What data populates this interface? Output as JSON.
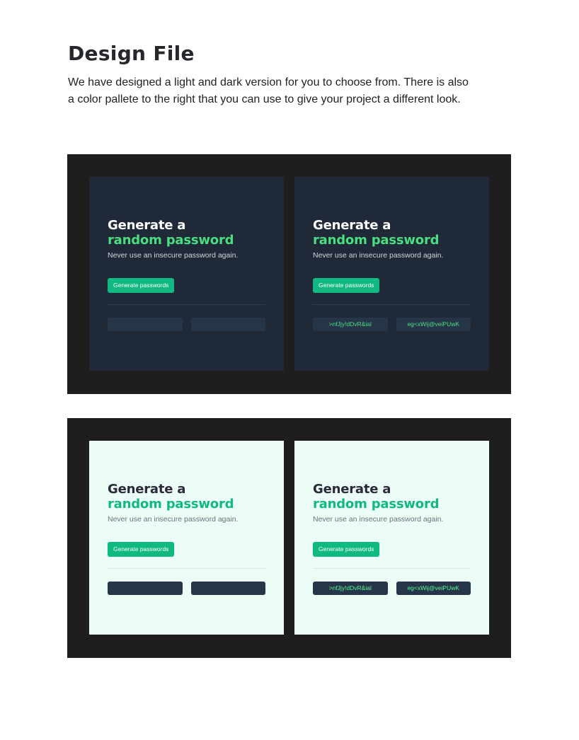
{
  "header": {
    "title": "Design File",
    "intro": "We have designed a light and dark version for you to choose from. There is also a color pallete to the right that you can use to give your project a different look."
  },
  "card": {
    "heading_line1": "Generate a",
    "heading_line2": "random password",
    "subtitle": "Never use an insecure password again.",
    "button_label": "Generate passwords",
    "password_1": ">nfJjy!dDvR&ial",
    "password_2": "eg<xWij@veiPUwK"
  },
  "colors": {
    "frame_bg": "#1e1e1e",
    "dark_card_bg": "#1f2937",
    "light_card_bg": "#ecfdf5",
    "accent_green": "#10b981",
    "bright_green": "#4ade80",
    "password_box_bg": "#273549"
  }
}
